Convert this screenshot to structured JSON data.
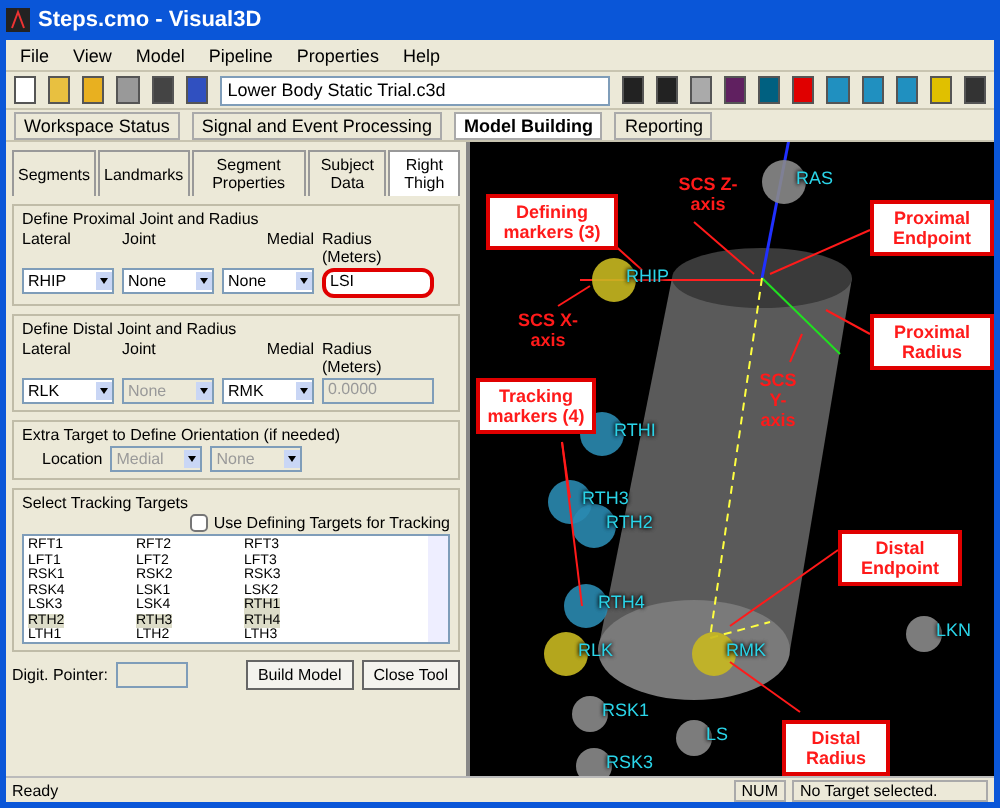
{
  "window": {
    "title": "Steps.cmo - Visual3D"
  },
  "menu": [
    "File",
    "View",
    "Model",
    "Pipeline",
    "Properties",
    "Help"
  ],
  "toolbar": {
    "file_combo": "Lower Body Static Trial.c3d"
  },
  "workspace_tabs": [
    {
      "label": "Workspace Status",
      "selected": false
    },
    {
      "label": "Signal and Event Processing",
      "selected": false
    },
    {
      "label": "Model Building",
      "selected": true
    },
    {
      "label": "Reporting",
      "selected": false
    }
  ],
  "model_tabs": [
    {
      "label": "Segments",
      "selected": false
    },
    {
      "label": "Landmarks",
      "selected": false
    },
    {
      "label": "Segment Properties",
      "selected": false
    },
    {
      "label": "Subject Data",
      "selected": false
    },
    {
      "label": "Right Thigh",
      "selected": true
    }
  ],
  "proximal": {
    "title": "Define Proximal Joint and Radius",
    "lateral_label": "Lateral",
    "lateral": "RHIP",
    "joint_label": "Joint",
    "joint": "None",
    "medial_label": "Medial",
    "medial": "None",
    "radius_label": "Radius (Meters)",
    "radius": "LSI",
    "radius_disabled": false,
    "highlighted": true
  },
  "distal": {
    "title": "Define Distal Joint and Radius",
    "lateral_label": "Lateral",
    "lateral": "RLK",
    "joint_label": "Joint",
    "joint": "None",
    "medial_label": "Medial",
    "medial": "RMK",
    "radius_label": "Radius (Meters)",
    "radius": "0.0000",
    "radius_disabled": true,
    "highlighted": false
  },
  "extra": {
    "title": "Extra Target to Define Orientation (if needed)",
    "location_label": "Location",
    "location": "Medial",
    "target": "None"
  },
  "tracking": {
    "title": "Select Tracking Targets",
    "use_defining": {
      "label": "Use Defining Targets for Tracking",
      "checked": false
    },
    "targets": [
      {
        "label": "RFT1",
        "selected": false
      },
      {
        "label": "RFT2",
        "selected": false
      },
      {
        "label": "RFT3",
        "selected": false
      },
      {
        "label": "LFT1",
        "selected": false
      },
      {
        "label": "LFT2",
        "selected": false
      },
      {
        "label": "LFT3",
        "selected": false
      },
      {
        "label": "RSK1",
        "selected": false
      },
      {
        "label": "RSK2",
        "selected": false
      },
      {
        "label": "RSK3",
        "selected": false
      },
      {
        "label": "RSK4",
        "selected": false
      },
      {
        "label": "LSK1",
        "selected": false
      },
      {
        "label": "LSK2",
        "selected": false
      },
      {
        "label": "LSK3",
        "selected": false
      },
      {
        "label": "LSK4",
        "selected": false
      },
      {
        "label": "RTH1",
        "selected": true
      },
      {
        "label": "RTH2",
        "selected": true
      },
      {
        "label": "RTH3",
        "selected": true
      },
      {
        "label": "RTH4",
        "selected": true
      },
      {
        "label": "LTH1",
        "selected": false
      },
      {
        "label": "LTH2",
        "selected": false
      },
      {
        "label": "LTH3",
        "selected": false
      }
    ]
  },
  "digit_pointer_label": "Digit. Pointer:",
  "buttons": [
    "Build Model",
    "Close Tool"
  ],
  "viewport": {
    "markers": [
      {
        "label": "RAS",
        "kind": "grey"
      },
      {
        "label": "RHIP",
        "kind": "defining"
      },
      {
        "label": "RTHI",
        "kind": "tracking"
      },
      {
        "label": "RTH3",
        "kind": "tracking"
      },
      {
        "label": "RTH2",
        "kind": "tracking"
      },
      {
        "label": "RTH4",
        "kind": "tracking"
      },
      {
        "label": "RLK",
        "kind": "defining"
      },
      {
        "label": "RMK",
        "kind": "defining"
      },
      {
        "label": "LKN",
        "kind": "grey"
      },
      {
        "label": "RSK1",
        "kind": "grey"
      },
      {
        "label": "LS",
        "kind": "grey"
      },
      {
        "label": "RSK3",
        "kind": "grey"
      }
    ],
    "callouts": [
      {
        "text": "Defining markers (3)",
        "boxed": true
      },
      {
        "text": "SCS Z-axis",
        "boxed": false
      },
      {
        "text": "SCS X-axis",
        "boxed": false
      },
      {
        "text": "Proximal Endpoint",
        "boxed": true
      },
      {
        "text": "Proximal Radius",
        "boxed": true
      },
      {
        "text": "SCS Y-axis",
        "boxed": false
      },
      {
        "text": "Tracking markers (4)",
        "boxed": true
      },
      {
        "text": "Distal Endpoint",
        "boxed": true
      },
      {
        "text": "Distal Radius",
        "boxed": true
      }
    ]
  },
  "status_bar": {
    "message": "Ready",
    "num": "NUM",
    "target": "No Target selected."
  }
}
